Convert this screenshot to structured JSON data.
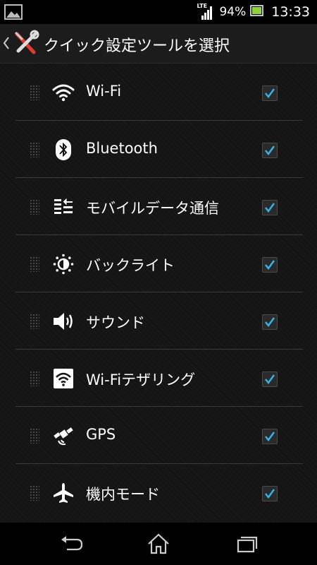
{
  "status_bar": {
    "network": "LTE",
    "battery_percent": "94%",
    "time": "13:33"
  },
  "action_bar": {
    "title": "クイック設定ツールを選択"
  },
  "tools": [
    {
      "label": "Wi-Fi",
      "icon": "wifi-icon",
      "checked": true
    },
    {
      "label": "Bluetooth",
      "icon": "bluetooth-icon",
      "checked": true
    },
    {
      "label": "モバイルデータ通信",
      "icon": "mobile-data-icon",
      "checked": true
    },
    {
      "label": "バックライト",
      "icon": "backlight-icon",
      "checked": true
    },
    {
      "label": "サウンド",
      "icon": "sound-icon",
      "checked": true
    },
    {
      "label": "Wi-Fiテザリング",
      "icon": "wifi-tethering-icon",
      "checked": true
    },
    {
      "label": "GPS",
      "icon": "gps-icon",
      "checked": true
    },
    {
      "label": "機内モード",
      "icon": "airplane-mode-icon",
      "checked": true
    }
  ],
  "colors": {
    "accent": "#33b5e5",
    "background": "#141414"
  }
}
